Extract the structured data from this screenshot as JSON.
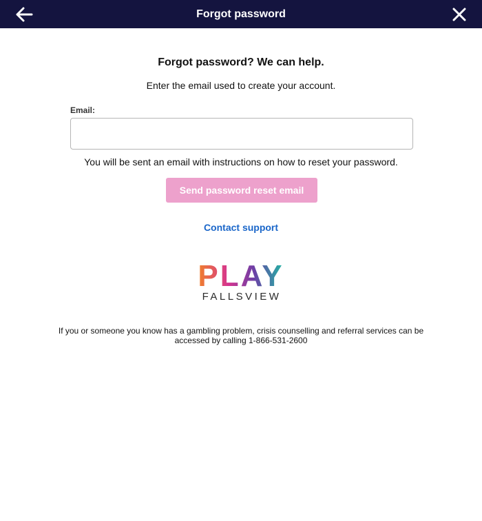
{
  "header": {
    "title": "Forgot password",
    "background": "#14143f",
    "back_icon": "arrow-left-icon",
    "close_icon": "close-icon"
  },
  "main": {
    "heading": "Forgot password? We can help.",
    "subtext": "Enter the email used to create your account.",
    "email_label": "Email:",
    "email_value": "",
    "email_placeholder": "",
    "info_text": "You will be sent an email with instructions on how to reset your password.",
    "send_button_label": "Send password reset email",
    "send_button_color": "#eda1cc",
    "contact_support_label": "Contact support",
    "link_color": "#1a66c9"
  },
  "logo": {
    "word": "PLAY",
    "subword": "FALLSVIEW",
    "colors": [
      "#f0802b",
      "#d6348f",
      "#6c3fa6",
      "#1fb8a4"
    ]
  },
  "disclaimer": {
    "text": "If you or someone you know has a gambling problem, crisis counselling and referral services can be accessed by calling 1-866-531-2600"
  }
}
